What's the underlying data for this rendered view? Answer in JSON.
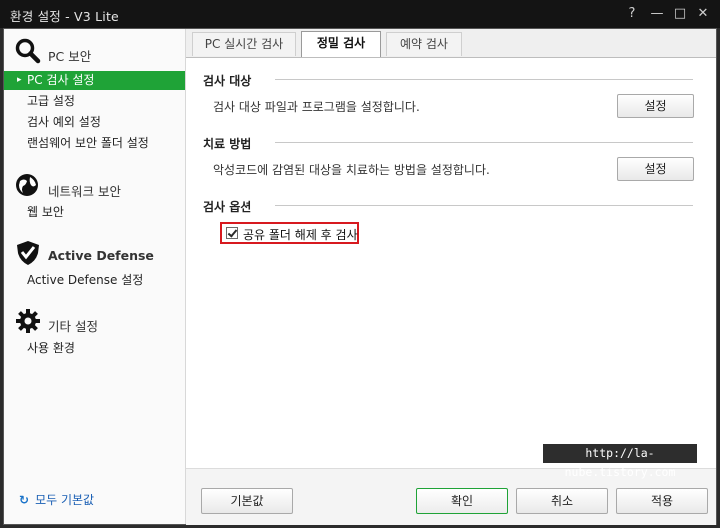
{
  "window": {
    "title": "환경 설정 - V3 Lite",
    "help": "?",
    "minimize": "—",
    "maximize": "□",
    "close": "✕"
  },
  "sidebar": {
    "sections": [
      {
        "label": "PC 보안",
        "icon": "magnifier-icon"
      },
      {
        "label": "네트워크 보안",
        "icon": "globe-icon"
      },
      {
        "label": "Active Defense",
        "icon": "shield-check-icon"
      },
      {
        "label": "기타 설정",
        "icon": "gear-icon"
      }
    ],
    "items": [
      {
        "label": "PC 검사 설정",
        "active": true
      },
      {
        "label": "고급 설정"
      },
      {
        "label": "검사 예외 설정"
      },
      {
        "label": "랜섬웨어 보안 폴더 설정"
      },
      {
        "label": "웹 보안"
      },
      {
        "label": "Active Defense 설정"
      },
      {
        "label": "사용 환경"
      }
    ],
    "reset": "모두 기본값",
    "active_color": "#1fa337"
  },
  "tabs": [
    {
      "label": "PC 실시간 검사"
    },
    {
      "label": "정밀 검사",
      "active": true
    },
    {
      "label": "예약 검사"
    }
  ],
  "groups": {
    "target": {
      "title": "검사 대상",
      "desc": "검사 대상 파일과 프로그램을 설정합니다.",
      "button": "설정"
    },
    "treat": {
      "title": "치료 방법",
      "desc": "악성코드에 감염된 대상을 치료하는 방법을 설정합니다.",
      "button": "설정"
    },
    "options": {
      "title": "검사 옵션",
      "checkbox_label": "공유 폴더 해제 후 검사",
      "checked": true
    }
  },
  "watermark": "http://la-nube.tistory.com",
  "footer": {
    "default": "기본값",
    "ok": "확인",
    "cancel": "취소",
    "apply": "적용"
  },
  "highlight_color": "#d7191f"
}
